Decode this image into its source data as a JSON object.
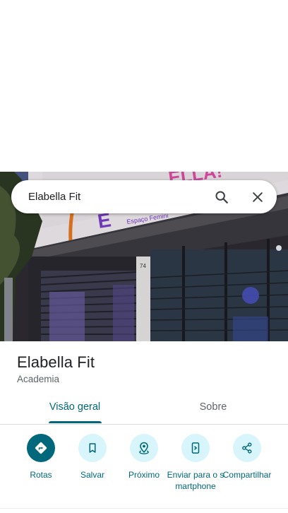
{
  "search": {
    "value": "Elabella Fit",
    "search_icon": "search-icon",
    "close_icon": "close-icon"
  },
  "photo": {
    "sign_text": "Espaço Femini",
    "number": "74"
  },
  "place": {
    "title": "Elabella Fit",
    "category": "Academia"
  },
  "tabs": [
    {
      "label": "Visão geral",
      "active": true
    },
    {
      "label": "Sobre",
      "active": false
    }
  ],
  "actions": [
    {
      "label": "Rotas",
      "icon": "directions-icon",
      "primary": true
    },
    {
      "label": "Salvar",
      "icon": "bookmark-icon",
      "primary": false
    },
    {
      "label": "Próximo",
      "icon": "nearby-icon",
      "primary": false
    },
    {
      "label": "Enviar para o smartphone",
      "icon": "send-to-phone-icon",
      "primary": false
    },
    {
      "label": "Compartilhar",
      "icon": "share-icon",
      "primary": false
    }
  ],
  "colors": {
    "accent": "#00687a",
    "accent_light": "#d7f5fb"
  }
}
